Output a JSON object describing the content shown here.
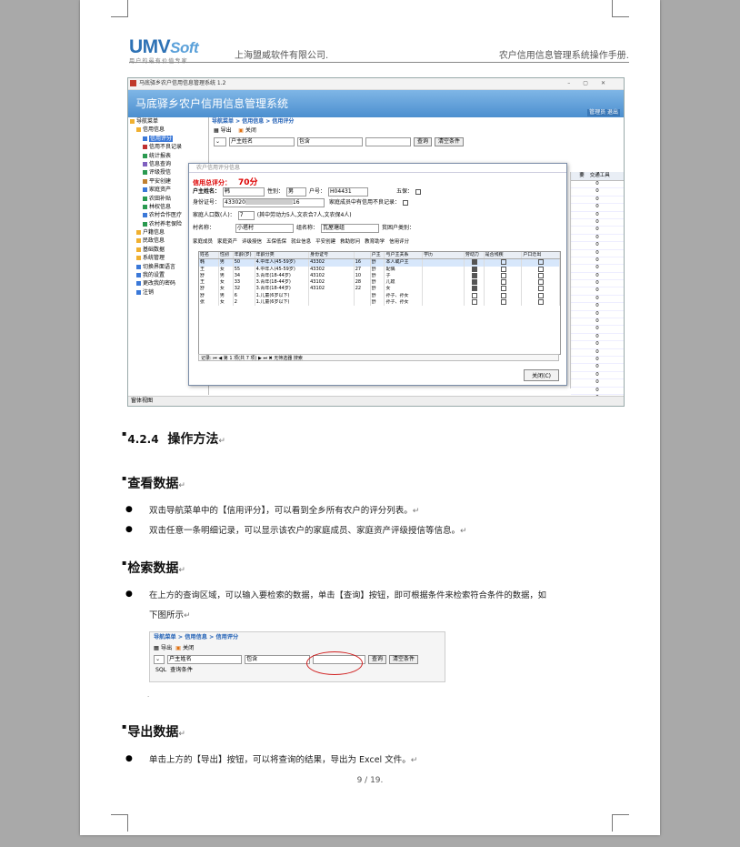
{
  "header": {
    "logo_main": "UMV",
    "logo_soft": "Soft",
    "logo_tagline": "用户的最有价值专家",
    "company": "上海盟威软件有限公司.",
    "doc_title": "农户信用信息管理系统操作手册."
  },
  "app": {
    "window_title": "马底驿乡农户信用信息管理系统 1.2",
    "banner_title": "马底驿乡农户信用信息管理系统",
    "help_label": "管理员  退出",
    "tree": [
      {
        "label": "导航菜单",
        "level": 0
      },
      {
        "label": "信用信息",
        "level": 1
      },
      {
        "label": "信用评分",
        "level": 2,
        "selected": true
      },
      {
        "label": "信用不良记录",
        "level": 2
      },
      {
        "label": "统计报表",
        "level": 2
      },
      {
        "label": "信息查询",
        "level": 2
      },
      {
        "label": "评级授信",
        "level": 2
      },
      {
        "label": "平安创建",
        "level": 2
      },
      {
        "label": "家庭资产",
        "level": 2
      },
      {
        "label": "农田补贴",
        "level": 2
      },
      {
        "label": "林权信息",
        "level": 2
      },
      {
        "label": "农村合作医疗",
        "level": 2
      },
      {
        "label": "农村养老保险",
        "level": 2
      },
      {
        "label": "户籍信息",
        "level": 1
      },
      {
        "label": "民政信息",
        "level": 1
      },
      {
        "label": "基础数据",
        "level": 1
      },
      {
        "label": "系统管理",
        "level": 1
      },
      {
        "label": "切换界面语言",
        "level": 1
      },
      {
        "label": "我的设置",
        "level": 1
      },
      {
        "label": "更改我的密码",
        "level": 1
      },
      {
        "label": "注销",
        "level": 1
      }
    ],
    "breadcrumb": "导航菜单 > 信用信息 > 信用评分",
    "toolbar": {
      "export": "导出",
      "close": "关闭"
    },
    "query": {
      "field": "户主姓名",
      "op": "包含",
      "search": "查询",
      "clear": "清空条件"
    },
    "side_grid": {
      "headers": [
        "要",
        "交通工具"
      ],
      "values": [
        "0",
        "0",
        "0",
        "0",
        "0",
        "0",
        "0",
        "0",
        "0",
        "0",
        "0",
        "0",
        "0",
        "0",
        "0",
        "0",
        "0",
        "0",
        "0",
        "0",
        "0",
        "0",
        "0",
        "0",
        "0",
        "0",
        "0",
        "0",
        "0",
        "0",
        "0"
      ]
    },
    "status": "窗体视图",
    "dialog": {
      "title": "农户信用评分信息",
      "score_label": "信用总评分：",
      "score": "70分",
      "householder_label": "户主姓名：",
      "householder": "韩",
      "gender_label": "性别：",
      "gender": "男",
      "hukou_label": "户号：",
      "hukou": "H04431",
      "wubao_label": "五保：",
      "id_label": "身份证号：",
      "id_value": "433020",
      "id_tail": "16",
      "bad_record_label": "家庭成员中有信用不良记录：",
      "family_count_label": "家庭人口数(人)：",
      "family_count": "7",
      "family_note": "(其中劳动力5人,文农合7人,文农保4人)",
      "village_label": "村名称：",
      "village": "小塔村",
      "group_label": "组名称：",
      "group": "瓦屋塘组",
      "poor_label": "贫困户类别：",
      "tabs": [
        "家庭成员",
        "家庭资产",
        "评级授信",
        "五保低保",
        "就业信息",
        "平安创建",
        "救助慰问",
        "教育助学",
        "信用评分"
      ],
      "grid_headers": [
        "姓名",
        "性别",
        "年龄(岁)",
        "年龄分类",
        "身份证号",
        "户主",
        "与户主关系",
        "学历",
        "劳动力",
        "是否残疾",
        "户口迁出"
      ],
      "grid_rows": [
        [
          "韩",
          "男",
          "50",
          "4.中年人(45-59岁)",
          "43302",
          "16",
          "舒",
          "本人或户主",
          "",
          "1",
          "0",
          "0"
        ],
        [
          "王",
          "女",
          "55",
          "4.中年人(45-59岁)",
          "43302",
          "27",
          "舒",
          "配偶",
          "",
          "1",
          "0",
          "0"
        ],
        [
          "舒",
          "男",
          "34",
          "3.青年(18-44岁)",
          "43102",
          "10",
          "舒",
          "子",
          "",
          "1",
          "0",
          "0"
        ],
        [
          "王",
          "女",
          "33",
          "3.青年(18-44岁)",
          "43102",
          "28",
          "舒",
          "儿媳",
          "",
          "1",
          "0",
          "0"
        ],
        [
          "舒",
          "女",
          "32",
          "3.青年(18-44岁)",
          "43102",
          "22",
          "舒",
          "女",
          "",
          "1",
          "0",
          "0"
        ],
        [
          "舒",
          "男",
          "6",
          "1.儿童(6岁以下)",
          "",
          "",
          "舒",
          "孙子、孙女",
          "",
          "0",
          "0",
          "0"
        ],
        [
          "张",
          "女",
          "2",
          "1.儿童(6岁以下)",
          "",
          "",
          "舒",
          "孙子、孙女",
          "",
          "0",
          "0",
          "0"
        ]
      ],
      "grid_nav": "记录: ⏮ ◀ 第 1 项(共 7 项) ▶ ⏭  ✖ 无筛选器  搜索",
      "close_label": "关闭(C)"
    }
  },
  "content": {
    "section_num": "4.2.4",
    "section_title": "操作方法",
    "h_view": "查看数据",
    "view_bullets": [
      "双击导航菜单中的【信用评分】，可以看到全乡所有农户的评分列表。",
      "双击任意一条明细记录，可以显示该农户的家庭成员、家庭资产评级授信等信息。"
    ],
    "h_search": "检索数据",
    "search_bullet_1": "在上方的查询区域，可以输入要检索的数据，单击【查询】按钮，即可根据条件来检索符合条件的数据，如",
    "search_bullet_2": "下图所示",
    "h_export": "导出数据",
    "export_bullet": "单击上方的【导出】按钮，可以将查询的结果，导出为 Excel 文件。",
    "query_shot": {
      "breadcrumb": "导航菜单 > 信用信息 > 信用评分",
      "export": "导出",
      "close": "关闭",
      "field": "户主姓名",
      "op": "包含",
      "search": "查询",
      "clear": "清空条件",
      "tab1": "SQL",
      "tab2": "查询条件"
    }
  },
  "page_number": "9 / 19."
}
